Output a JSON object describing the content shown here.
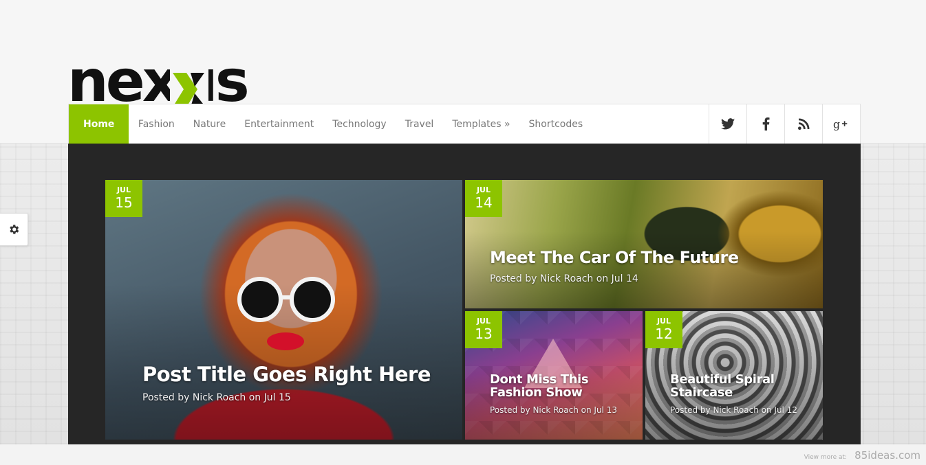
{
  "logo": {
    "text": "nexus",
    "accent_color": "#8dc400"
  },
  "nav": {
    "items": [
      {
        "label": "Home",
        "active": true
      },
      {
        "label": "Fashion"
      },
      {
        "label": "Nature"
      },
      {
        "label": "Entertainment"
      },
      {
        "label": "Technology"
      },
      {
        "label": "Travel"
      },
      {
        "label": "Templates »"
      },
      {
        "label": "Shortcodes"
      }
    ],
    "social": [
      "twitter-icon",
      "facebook-icon",
      "rss-icon",
      "google-plus-icon"
    ]
  },
  "posts": [
    {
      "month": "JUL",
      "day": "15",
      "title": "Post Title Goes Right Here",
      "meta": "Posted by Nick Roach on Jul 15"
    },
    {
      "month": "JUL",
      "day": "14",
      "title": "Meet The Car Of The Future",
      "meta": "Posted by Nick Roach on Jul 14"
    },
    {
      "month": "JUL",
      "day": "13",
      "title": "Dont Miss This Fashion Show",
      "meta": "Posted by Nick Roach on Jul 13"
    },
    {
      "month": "JUL",
      "day": "12",
      "title": "Beautiful Spiral Staircase",
      "meta": "Posted by Nick Roach on Jul 12"
    }
  ],
  "settings": {
    "icon": "gear-icon"
  },
  "footer": {
    "view_more": "View more at:",
    "site": "85ideas.com"
  }
}
